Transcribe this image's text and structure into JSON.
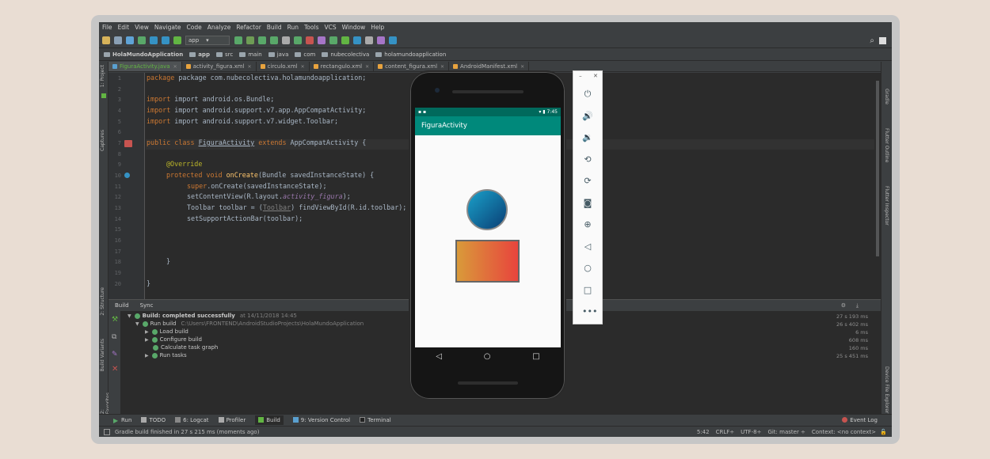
{
  "menu": [
    "File",
    "Edit",
    "View",
    "Navigate",
    "Code",
    "Analyze",
    "Refactor",
    "Build",
    "Run",
    "Tools",
    "VCS",
    "Window",
    "Help"
  ],
  "toolbar": {
    "config": "app"
  },
  "breadcrumbs": [
    "HolaMundoApplication",
    "app",
    "src",
    "main",
    "java",
    "com",
    "nubecolectiva",
    "holamundoapplication"
  ],
  "tabs": [
    "FiguraActivity.java",
    "activity_figura.xml",
    "circulo.xml",
    "rectangulo.xml",
    "content_figura.xml",
    "AndroidManifest.xml"
  ],
  "left_strip": [
    "1: Project",
    "Captures",
    "2: Structure",
    "Build Variants",
    "2: Favorites"
  ],
  "right_strip": [
    "Gradle",
    "Flutter Outline",
    "Flutter Inspector",
    "Device File Explorer"
  ],
  "line_numbers": [
    "1",
    "2",
    "3",
    "4",
    "5",
    "6",
    "7",
    "8",
    "9",
    "10",
    "11",
    "12",
    "13",
    "14",
    "15",
    "16",
    "17",
    "18",
    "19",
    "20"
  ],
  "code": {
    "l1": "package com.nubecolectiva.holamundoapplication;",
    "l3": "import android.os.Bundle;",
    "l4": "import android.support.v7.app.AppCompatActivity;",
    "l5": "import android.support.v7.widget.Toolbar;",
    "l7a": "public class ",
    "l7b": "FiguraActivity",
    "l7c": " extends ",
    "l7d": "AppCompatActivity {",
    "l9": "@Override",
    "l10a": "protected void ",
    "l10b": "onCreate",
    "l10c": "(Bundle savedInstanceState) {",
    "l11a": "super",
    "l11b": ".onCreate(savedInstanceState);",
    "l12a": "setContentView(R.layout.",
    "l12b": "activity_figura",
    "l12c": ");",
    "l13a": "Toolbar toolbar = (",
    "l13b": "Toolbar",
    "l13c": ") findViewById(R.id.toolbar);",
    "l14": "setSupportActionBar(toolbar);",
    "l18": "}",
    "l20": "}"
  },
  "build": {
    "tabs": [
      "Build",
      "Sync"
    ],
    "rows": [
      {
        "text": "Build: completed successfully",
        "dim": "at 14/11/2018 14:45",
        "time": "27 s 193 ms"
      },
      {
        "text": "Run build",
        "dim": "C:\\Users\\FRONTEND\\AndroidStudioProjects\\HolaMundoApplication",
        "time": "26 s 402 ms"
      },
      {
        "text": "Load build",
        "dim": "",
        "time": "6 ms"
      },
      {
        "text": "Configure build",
        "dim": "",
        "time": "608 ms"
      },
      {
        "text": "Calculate task graph",
        "dim": "",
        "time": "160 ms"
      },
      {
        "text": "Run tasks",
        "dim": "",
        "time": "25 s 451 ms"
      }
    ]
  },
  "window_bar": [
    "Run",
    "TODO",
    "6: Logcat",
    "Profiler",
    "Build",
    "9: Version Control",
    "Terminal",
    "Event Log"
  ],
  "status": {
    "message": "Gradle build finished in 27 s 215 ms (moments ago)",
    "pos": "5:42",
    "line_sep": "CRLF÷",
    "encoding": "UTF-8÷",
    "git": "Git: master ÷",
    "context": "Context: <no context>"
  },
  "emulator": {
    "time": "7:45",
    "app_title": "FiguraActivity",
    "buttons": [
      "power-icon",
      "volume-up-icon",
      "volume-down-icon",
      "rotate-left-icon",
      "rotate-right-icon",
      "camera-icon",
      "zoom-icon",
      "back-icon",
      "home-icon",
      "overview-icon",
      "more-icon"
    ]
  },
  "colors": {
    "accent": "#00897b",
    "accent_dark": "#00695c",
    "ok": "#59a869",
    "keyword": "#cc7832"
  }
}
